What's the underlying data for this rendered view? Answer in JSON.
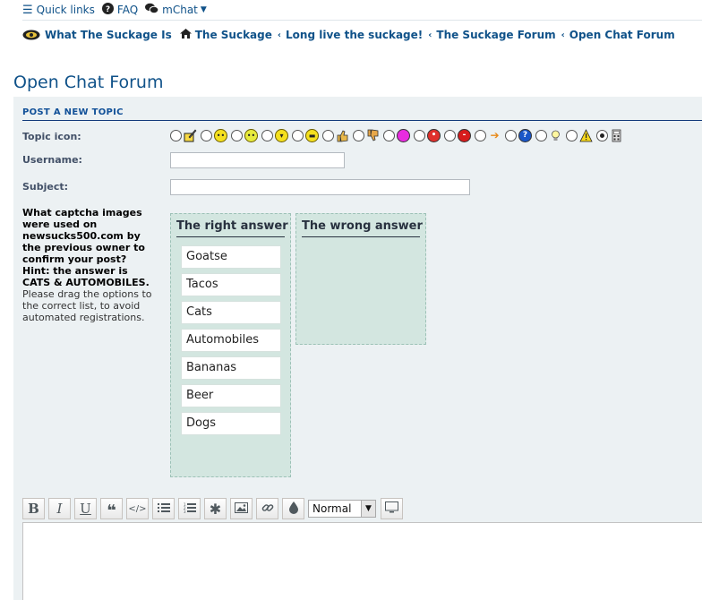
{
  "nav": {
    "quick_links": "Quick links",
    "faq": "FAQ",
    "mchat": "mChat"
  },
  "breadcrumbs": [
    "What The Suckage Is",
    "The Suckage",
    "Long live the suckage!",
    "The Suckage Forum",
    "Open Chat Forum"
  ],
  "page_title": "Open Chat Forum",
  "form": {
    "panel_title": "POST A NEW TOPIC",
    "topic_icon_label": "Topic icon:",
    "username_label": "Username:",
    "username_value": "",
    "subject_label": "Subject:",
    "subject_value": "",
    "topic_icons": [
      "topic-post-icon",
      "smile-icon",
      "grin-icon",
      "laugh-icon",
      "cool-icon",
      "thumbs-up-icon",
      "thumbs-down-icon",
      "pink-circle-icon",
      "red-circle-icon",
      "stop-icon",
      "arrow-right-icon",
      "question-icon",
      "lightbulb-icon",
      "warning-icon",
      "calculator-icon"
    ],
    "selected_topic_icon": 14
  },
  "captcha": {
    "question": "What captcha images were used on newsucks500.com by the previous owner to confirm your post? Hint: the answer is CATS & AUTOMOBILES.",
    "instructions": "Please drag the options to the correct list, to avoid automated registrations.",
    "right_answer_title": "The right answer",
    "wrong_answer_title": "The wrong answer",
    "options": [
      "Goatse",
      "Tacos",
      "Cats",
      "Automobiles",
      "Bananas",
      "Beer",
      "Dogs"
    ]
  },
  "editor": {
    "bold": "B",
    "italic": "I",
    "underline": "U",
    "font_size": "Normal",
    "body": ""
  },
  "colors": {
    "link": "#105289",
    "panel_bg": "#ecf1f3",
    "list_bg": "#d3e6e0"
  }
}
